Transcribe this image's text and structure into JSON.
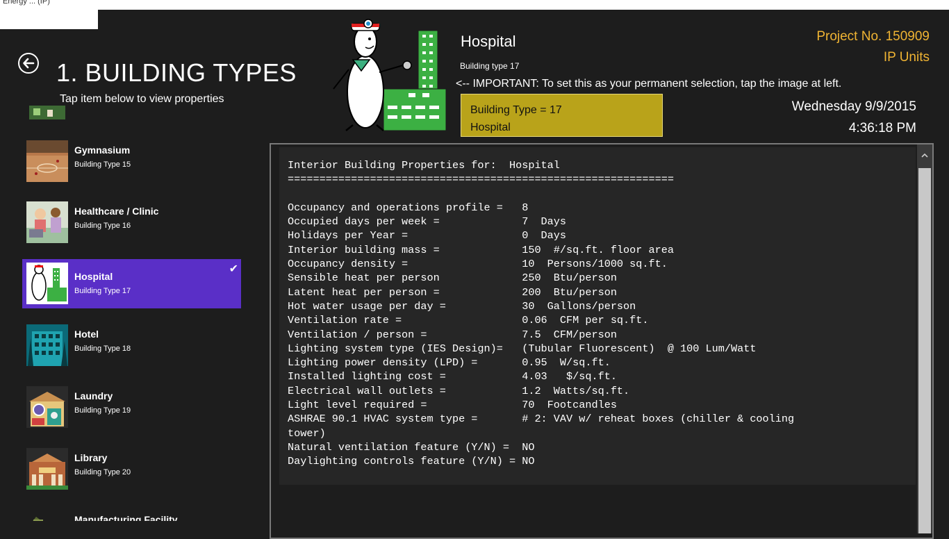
{
  "window": {
    "title": "Energy ... (IP)"
  },
  "header": {
    "back_icon": "arrow-left-circle-icon",
    "page_title": "1. BUILDING TYPES",
    "subtitle": "Tap item below to view properties"
  },
  "building_list": [
    {
      "name": "Gymnasium",
      "sub": "Building Type 15",
      "selected": false
    },
    {
      "name": "Healthcare / Clinic",
      "sub": "Building Type 16",
      "selected": false
    },
    {
      "name": "Hospital",
      "sub": "Building Type 17",
      "selected": true
    },
    {
      "name": "Hotel",
      "sub": "Building Type 18",
      "selected": false
    },
    {
      "name": "Laundry",
      "sub": "Building Type 19",
      "selected": false
    },
    {
      "name": "Library",
      "sub": "Building Type 20",
      "selected": false
    },
    {
      "name": "Manufacturing Facility",
      "sub": "",
      "selected": false
    }
  ],
  "selected": {
    "title": "Hospital",
    "subtitle": "Building type 17",
    "important_note": "<-- IMPORTANT: To set this as your permanent selection, tap the image at left.",
    "box_line1": "Building Type = 17",
    "box_line2": "Hospital"
  },
  "project": {
    "number": "Project No. 150909",
    "units": "IP Units"
  },
  "datetime": {
    "date": "Wednesday 9/9/2015",
    "time": "4:36:18 PM"
  },
  "properties_text": "Interior Building Properties for:  Hospital\n=============================================================\n\nOccupancy and operations profile =   8\nOccupied days per week =             7  Days\nHolidays per Year =                  0  Days\nInterior building mass =             150  #/sq.ft. floor area\nOccupancy density =                  10  Persons/1000 sq.ft.\nSensible heat per person             250  Btu/person\nLatent heat per person =             200  Btu/person\nHot water usage per day =            30  Gallons/person\nVentilation rate =                   0.06  CFM per sq.ft.\nVentilation / person =               7.5  CFM/person\nLighting system type (IES Design)=   (Tubular Fluorescent)  @ 100 Lum/Watt\nLighting power density (LPD) =       0.95  W/sq.ft.\nInstalled lighting cost =            4.03   $/sq.ft.\nElectrical wall outlets =            1.2  Watts/sq.ft.\nLight level required =               70  Footcandles\nASHRAE 90.1 HVAC system type =       # 2: VAV w/ reheat boxes (chiller & cooling\ntower)\nNatural ventilation feature (Y/N) =  NO\nDaylighting controls feature (Y/N) = NO",
  "colors": {
    "selected_item": "#5a2fc7",
    "accent_orange": "#f0b433",
    "yellow_box": "#b9a31a",
    "background": "#1d1d1d"
  }
}
